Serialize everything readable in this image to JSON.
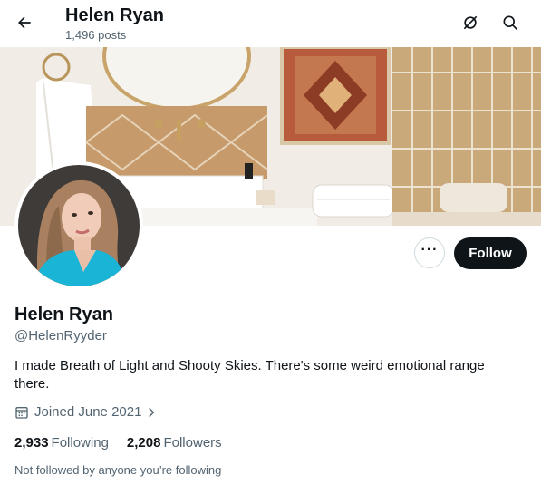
{
  "header": {
    "name": "Helen Ryan",
    "posts": "1,496 posts"
  },
  "icons": {
    "back": "back-arrow-icon",
    "notifications_off": "bell-off-icon",
    "search": "search-icon",
    "more": "more-icon",
    "calendar": "calendar-icon",
    "chevron": "chevron-right-icon"
  },
  "profile": {
    "display_name": "Helen Ryan",
    "handle": "@HelenRyyder",
    "bio": "I made Breath of Light and Shooty Skies. There's some weird emotional range there.",
    "joined": "Joined June 2021",
    "following_count": "2,933",
    "following_label": "Following",
    "followers_count": "2,208",
    "followers_label": "Followers",
    "mutuals": "Not followed by anyone you’re following"
  },
  "actions": {
    "more_label": "···",
    "follow_label": "Follow"
  },
  "colors": {
    "text": "#0f1419",
    "secondary": "#536471",
    "button_bg": "#0f1419",
    "avatar_top": "#1ab5d6"
  }
}
